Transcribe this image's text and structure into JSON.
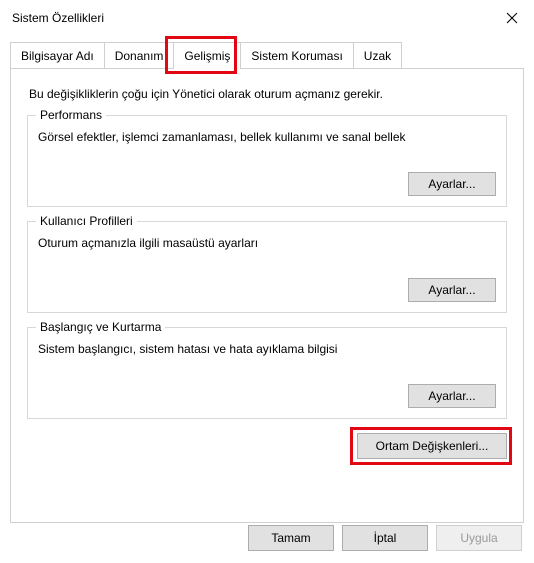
{
  "window": {
    "title": "Sistem Özellikleri"
  },
  "tabs": {
    "items": [
      {
        "label": "Bilgisayar Adı"
      },
      {
        "label": "Donanım"
      },
      {
        "label": "Gelişmiş"
      },
      {
        "label": "Sistem Koruması"
      },
      {
        "label": "Uzak"
      }
    ],
    "activeIndex": 2
  },
  "panel": {
    "intro": "Bu değişikliklerin çoğu için Yönetici olarak oturum açmanız gerekir.",
    "groups": {
      "performance": {
        "legend": "Performans",
        "desc": "Görsel efektler, işlemci zamanlaması, bellek kullanımı ve sanal bellek",
        "button": "Ayarlar..."
      },
      "profiles": {
        "legend": "Kullanıcı Profilleri",
        "desc": "Oturum açmanızla ilgili masaüstü ayarları",
        "button": "Ayarlar..."
      },
      "startup": {
        "legend": "Başlangıç ve Kurtarma",
        "desc": "Sistem başlangıcı, sistem hatası ve hata ayıklama bilgisi",
        "button": "Ayarlar..."
      }
    },
    "envButton": "Ortam Değişkenleri..."
  },
  "buttons": {
    "ok": "Tamam",
    "cancel": "İptal",
    "apply": "Uygula"
  }
}
